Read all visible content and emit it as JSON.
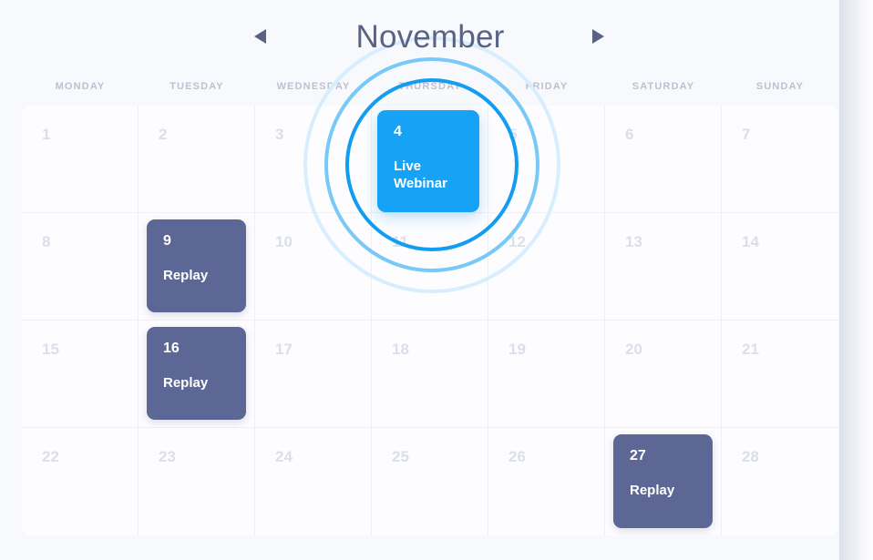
{
  "header": {
    "month": "November",
    "prev_icon": "triangle-left-icon",
    "next_icon": "triangle-right-icon"
  },
  "weekdays": [
    "MONDAY",
    "TUESDAY",
    "WEDNESDAY",
    "THURSDAY",
    "FRIDAY",
    "SATURDAY",
    "SUNDAY"
  ],
  "colors": {
    "live_event": "#17a3f5",
    "replay_event": "#5d6796",
    "month_title": "#5a6384",
    "weekday_label": "#bcc0d0",
    "day_number": "#dcdee8",
    "ring_inner": "#139df0",
    "ring_mid": "#79c9f8",
    "ring_outer": "#d7eeff",
    "page_background": "#f8f9fc",
    "grid_background": "#fdfdff",
    "grid_line": "#eef0f6"
  },
  "weeks": [
    [
      {
        "day": "1"
      },
      {
        "day": "2"
      },
      {
        "day": "3"
      },
      {
        "day": "4",
        "event": "Live Webinar",
        "type": "live"
      },
      {
        "day": "5"
      },
      {
        "day": "6"
      },
      {
        "day": "7"
      }
    ],
    [
      {
        "day": "8"
      },
      {
        "day": "9",
        "event": "Replay",
        "type": "replay"
      },
      {
        "day": "10"
      },
      {
        "day": "11"
      },
      {
        "day": "12"
      },
      {
        "day": "13"
      },
      {
        "day": "14"
      }
    ],
    [
      {
        "day": "15"
      },
      {
        "day": "16",
        "event": "Replay",
        "type": "replay"
      },
      {
        "day": "17"
      },
      {
        "day": "18"
      },
      {
        "day": "19"
      },
      {
        "day": "20"
      },
      {
        "day": "21"
      }
    ],
    [
      {
        "day": "22"
      },
      {
        "day": "23"
      },
      {
        "day": "24"
      },
      {
        "day": "25"
      },
      {
        "day": "26"
      },
      {
        "day": "27",
        "event": "Replay",
        "type": "replay"
      },
      {
        "day": "28"
      }
    ]
  ],
  "focus_highlight": {
    "target_day": "4",
    "target_label": "Live Webinar"
  }
}
